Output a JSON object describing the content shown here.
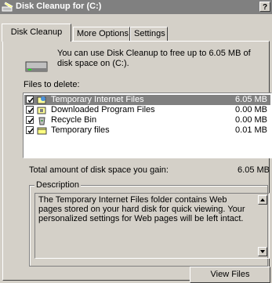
{
  "window": {
    "title": "Disk Cleanup for  (C:)",
    "help_label": "?"
  },
  "tabs": [
    {
      "label": "Disk Cleanup"
    },
    {
      "label": "More Options"
    },
    {
      "label": "Settings"
    }
  ],
  "intro_text": "You can use Disk Cleanup to free up to 6.05 MB of disk space on  (C:).",
  "files_label": "Files to delete:",
  "files": [
    {
      "checked": true,
      "name": "Temporary Internet Files",
      "size": "6.05 MB",
      "icon": "internet-files-icon"
    },
    {
      "checked": true,
      "name": "Downloaded Program Files",
      "size": "0.00 MB",
      "icon": "program-files-icon"
    },
    {
      "checked": true,
      "name": "Recycle Bin",
      "size": "0.00 MB",
      "icon": "recycle-bin-icon"
    },
    {
      "checked": true,
      "name": "Temporary files",
      "size": "0.01 MB",
      "icon": "temp-files-icon"
    }
  ],
  "total_label": "Total amount of disk space you gain:",
  "total_value": "6.05 MB",
  "description": {
    "legend": "Description",
    "text": "The Temporary Internet Files folder contains Web pages stored on your hard disk for quick viewing. Your personalized settings for Web pages will be left intact."
  },
  "view_files_label": "View Files",
  "colors": {
    "selected_row": "#808080",
    "dialog_bg": "#d4d0c8",
    "titlebar": "#808080"
  }
}
